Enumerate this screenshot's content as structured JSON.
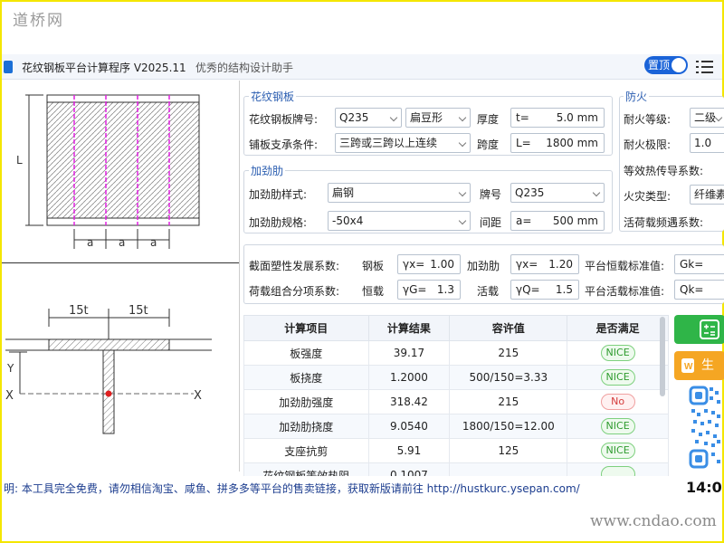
{
  "watermark_top": "道桥网",
  "watermark_bottom": "www.cndao.com",
  "app": {
    "title": "花纹钢板平台计算程序 V2025.11",
    "subtitle": "优秀的结构设计助手",
    "pin_label": "置顶"
  },
  "diagram": {
    "plate_label_L": "L",
    "spacing_label": "a",
    "flange_label": "15t",
    "axis_x": "X",
    "axis_y": "Y"
  },
  "plate_group": {
    "title": "花纹钢板",
    "grade_label": "花纹钢板牌号:",
    "grade_value": "Q235",
    "pattern_value": "扁豆形",
    "thickness_label": "厚度",
    "thickness_prefix": "t=",
    "thickness_value": "5.0 mm",
    "support_label": "铺板支承条件:",
    "support_value": "三跨或三跨以上连续",
    "span_label": "跨度",
    "span_prefix": "L=",
    "span_value": "1800 mm"
  },
  "rib_group": {
    "title": "加劲肋",
    "style_label": "加劲肋样式:",
    "style_value": "扁钢",
    "grade_label": "牌号",
    "grade_value": "Q235",
    "spec_label": "加劲肋规格:",
    "spec_value": "-50x4",
    "spacing_label": "间距",
    "spacing_prefix": "a=",
    "spacing_value": "500 mm"
  },
  "fire_group": {
    "title": "防火",
    "level_label": "耐火等级:",
    "level_value": "二级",
    "limit_label": "耐火极限:",
    "limit_value": "1.0",
    "conductivity_label": "等效热传导系数:",
    "fire_type_label": "火灾类型:",
    "fire_type_value": "纤维素",
    "freq_label": "活荷载频遇系数:"
  },
  "coef": {
    "plastic_label": "截面塑性发展系数:",
    "plate_label": "钢板",
    "gx_prefix": "γx=",
    "gx_value": "1.00",
    "rib_label": "加劲肋",
    "gx2_prefix": "γx=",
    "gx2_value": "1.20",
    "dead_label": "平台恒载标准值:",
    "gk_prefix": "Gk=",
    "combo_label": "荷载组合分项系数:",
    "dead2_label": "恒载",
    "gg_prefix": "γG=",
    "gg_value": "1.3",
    "live2_label": "活载",
    "gq_prefix": "γQ=",
    "gq_value": "1.5",
    "live_label": "平台活载标准值:",
    "qk_prefix": "Qk="
  },
  "table": {
    "headers": [
      "计算项目",
      "计算结果",
      "容许值",
      "是否满足"
    ],
    "rows": [
      {
        "item": "板强度",
        "result": "39.17",
        "allow": "215",
        "status": "NICE",
        "ok": true
      },
      {
        "item": "板挠度",
        "result": "1.2000",
        "allow": "500/150=3.33",
        "status": "NICE",
        "ok": true
      },
      {
        "item": "加劲肋强度",
        "result": "318.42",
        "allow": "215",
        "status": "No",
        "ok": false
      },
      {
        "item": "加劲肋挠度",
        "result": "9.0540",
        "allow": "1800/150=12.00",
        "status": "NICE",
        "ok": true
      },
      {
        "item": "支座抗剪",
        "result": "5.91",
        "allow": "125",
        "status": "NICE",
        "ok": true
      },
      {
        "item": "花纹钢板等效热阻",
        "result": "0.1007",
        "allow": "",
        "status": "",
        "ok": true
      }
    ]
  },
  "side": {
    "generate_label": "生成"
  },
  "status": {
    "text": "明:    本工具完全免费，请勿相信淘宝、咸鱼、拼多多等平台的售卖链接，获取新版请前往 http://hustkurc.ysepan.com/",
    "time": "14:0",
    "colors": {
      "accent": "#1a63d8",
      "ok": "#2e9b2e",
      "no": "#d43c3c",
      "calc_btn": "#2fb548",
      "gen_btn": "#f5a623"
    }
  }
}
